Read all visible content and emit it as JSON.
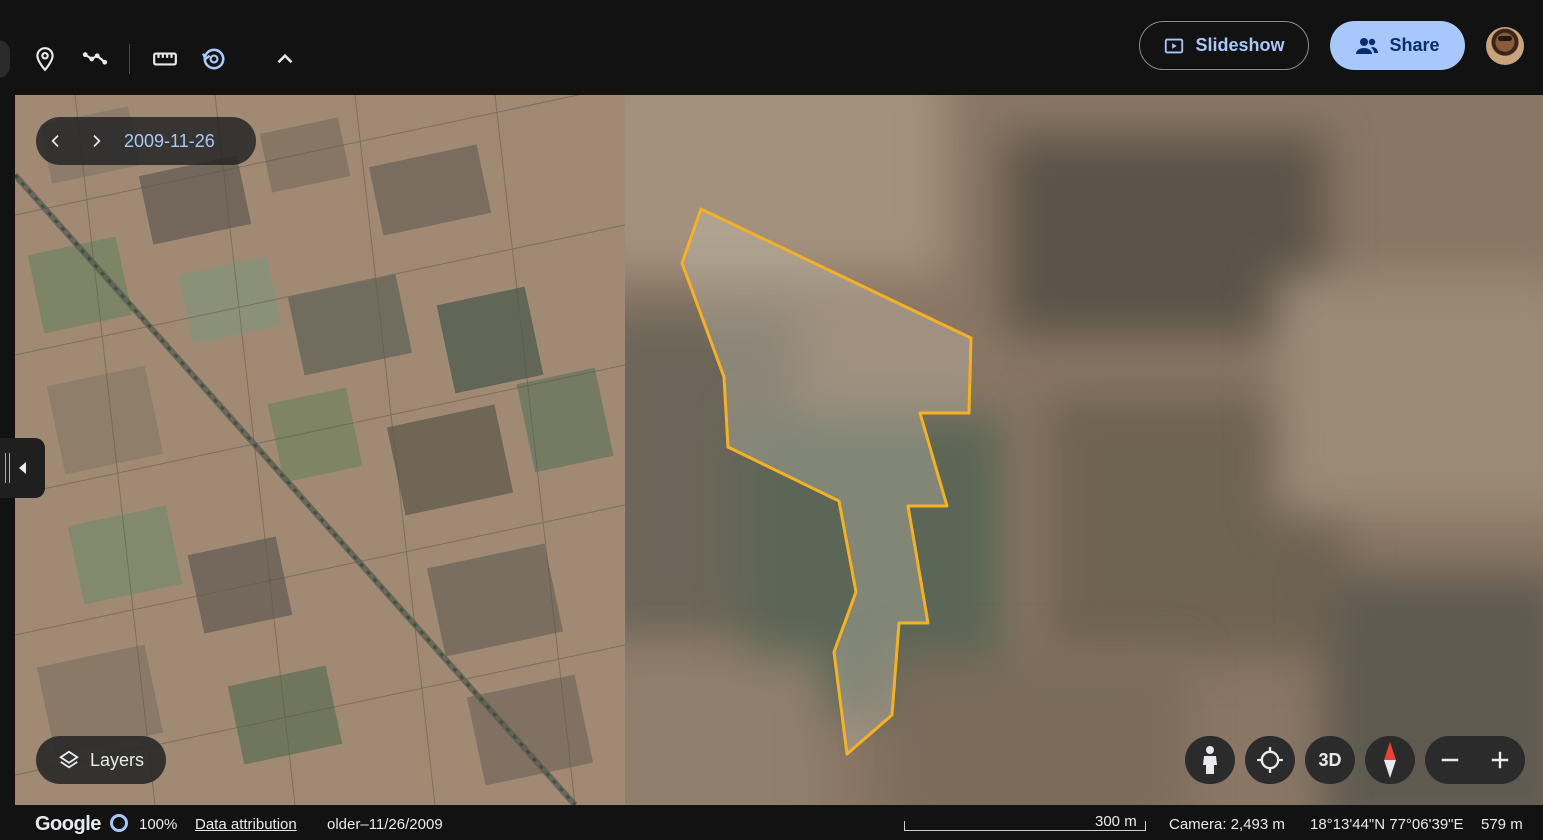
{
  "toolbar": {
    "tools": [
      {
        "name": "placemark-icon"
      },
      {
        "name": "path-icon"
      },
      {
        "name": "ruler-icon"
      },
      {
        "name": "historical-imagery-icon"
      },
      {
        "name": "collapse-chevron-icon"
      }
    ],
    "slideshow_label": "Slideshow",
    "share_label": "Share",
    "accent_color": "#a8c7fa"
  },
  "map": {
    "date": "2009-11-26",
    "polygon_color": "#f5b125",
    "layers_label": "Layers",
    "controls": {
      "street_view": "pegman-icon",
      "locate": "my-location-icon",
      "view_3d_label": "3D",
      "compass": "compass-icon",
      "zoom_out": "minus-icon",
      "zoom_in": "plus-icon"
    }
  },
  "status": {
    "logo": "Google",
    "load_percent": "100%",
    "attribution_label": "Data attribution",
    "imagery_date": "older–11/26/2009",
    "scale_label": "300 m",
    "camera": "Camera: 2,493 m",
    "coordinates": "18°13'44\"N 77°06'39\"E",
    "elevation": "579 m"
  }
}
